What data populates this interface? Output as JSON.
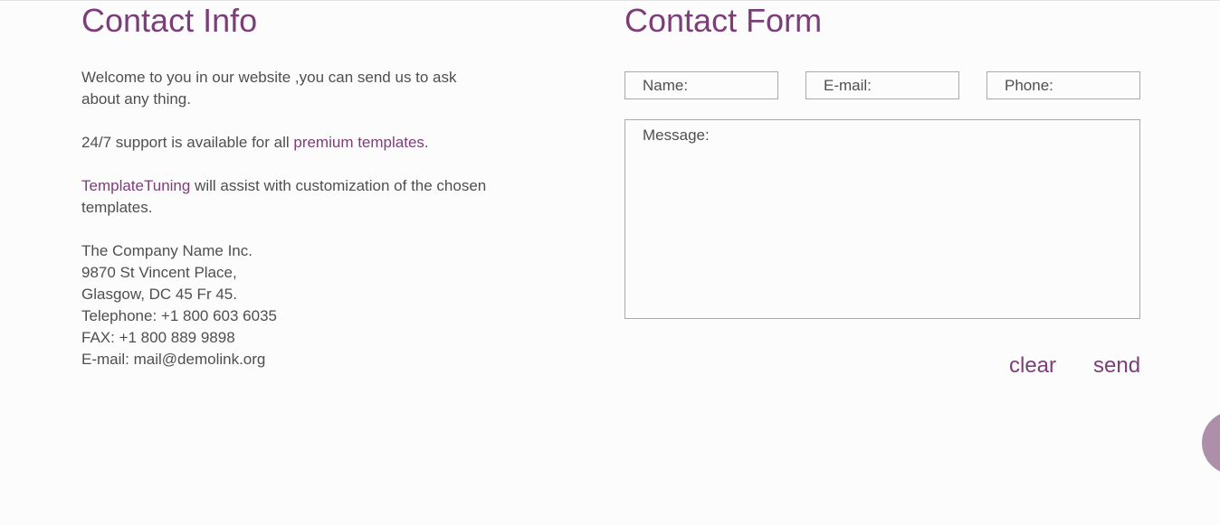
{
  "contact_info": {
    "title": "Contact Info",
    "welcome": "Welcome to you in our website ,you can send us to ask about any thing.",
    "support_prefix": "24/7 support is available for all ",
    "support_link": "premium templates",
    "support_suffix": ".",
    "tuning_link": "TemplateTuning",
    "tuning_suffix": " will assist with customization of the chosen templates.",
    "address": {
      "company": "The Company Name Inc.",
      "street": "9870 St Vincent Place,",
      "city": "Glasgow, DC 45 Fr 45.",
      "telephone": "Telephone: +1 800 603 6035",
      "fax": "FAX: +1 800 889 9898",
      "email": "E-mail: mail@demolink.org"
    }
  },
  "contact_form": {
    "title": "Contact Form",
    "name_label": "Name:",
    "email_label": "E-mail:",
    "phone_label": "Phone:",
    "message_label": "Message:",
    "clear_label": "clear",
    "send_label": "send"
  },
  "colors": {
    "accent": "#7c3e79",
    "text": "#4f4f4f",
    "border": "#a9a9a9",
    "background": "#fdfcfd",
    "scroll_dot": "#ad8fa9"
  }
}
